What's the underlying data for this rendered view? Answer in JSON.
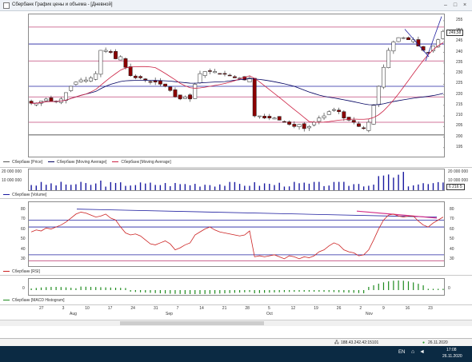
{
  "window": {
    "title": "Сбербанк График цены и объема - [Дневной]"
  },
  "price_panel": {
    "y_ticks": [
      "255",
      "250",
      "245",
      "240",
      "235",
      "230",
      "225",
      "220",
      "215",
      "210",
      "205",
      "200",
      "195"
    ],
    "legend": [
      "Сбербанк [Price]",
      "Сбербанк [Moving Average]",
      "Сбербанк [Moving Average]"
    ],
    "last_price": "249,58"
  },
  "volume_panel": {
    "y_ticks": [
      "20 000 000",
      "10 000 000"
    ],
    "legend": [
      "Сбербанк [Volume]"
    ],
    "last_volume": "6 216 5"
  },
  "rsi_panel": {
    "y_ticks": [
      "80",
      "70",
      "60",
      "50",
      "40",
      "30"
    ],
    "legend": [
      "Сбербанк [RSI]"
    ]
  },
  "macd_panel": {
    "y_ticks": [
      "0"
    ],
    "legend": [
      "Сбербанк [MACD Histogram]"
    ]
  },
  "x_axis": {
    "day_ticks": [
      "27",
      "3",
      "10",
      "17",
      "24",
      "31",
      "7",
      "14",
      "21",
      "28",
      "5",
      "12",
      "19",
      "26",
      "2",
      "9",
      "16",
      "23"
    ],
    "months": [
      "Aug",
      "Sep",
      "Oct",
      "Nov"
    ]
  },
  "status": {
    "ip": "188.43.242.42:15101",
    "date": "26.11.2020"
  },
  "taskbar": {
    "lang": "EN",
    "time": "17:08",
    "date": "26.11.2020"
  },
  "colors": {
    "up": "#ffffff",
    "down": "#8b0000",
    "ma_long": "#000060",
    "ma_short": "#cc2244",
    "volume": "#1a1aa0",
    "rsi": "#cc2222",
    "macd": "#1f8b1f",
    "hline_blue": "#2020a0",
    "hline_pink": "#c0487a"
  }
}
